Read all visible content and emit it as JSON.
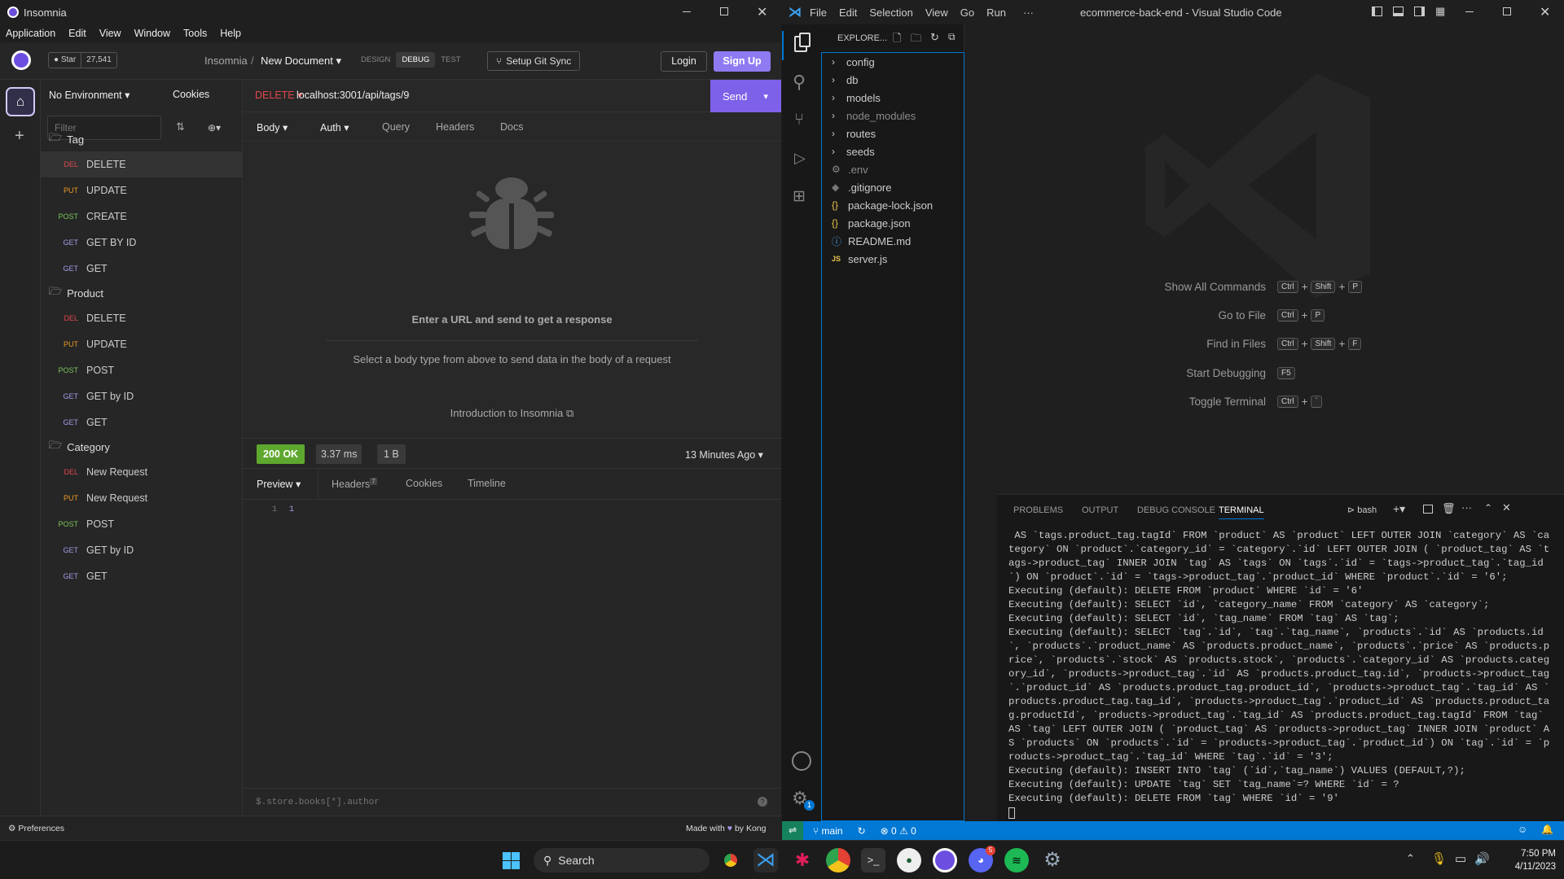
{
  "insomnia": {
    "window_title": "Insomnia",
    "menu": [
      "Application",
      "Edit",
      "View",
      "Window",
      "Tools",
      "Help"
    ],
    "star_label": "Star",
    "star_count": "27,541",
    "breadcrumb_root": "Insomnia",
    "breadcrumb_sep": "/",
    "breadcrumb_doc": "New Document",
    "tabs": [
      "DESIGN",
      "DEBUG",
      "TEST"
    ],
    "git_sync": "Setup Git Sync",
    "login": "Login",
    "signup": "Sign Up",
    "environment": "No Environment",
    "cookies": "Cookies",
    "filter_placeholder": "Filter",
    "folders": [
      {
        "name": "Tag",
        "items": [
          {
            "method": "DEL",
            "label": "DELETE"
          },
          {
            "method": "PUT",
            "label": "UPDATE"
          },
          {
            "method": "POST",
            "label": "CREATE"
          },
          {
            "method": "GET",
            "label": "GET BY ID"
          },
          {
            "method": "GET",
            "label": "GET"
          }
        ]
      },
      {
        "name": "Product",
        "items": [
          {
            "method": "DEL",
            "label": "DELETE"
          },
          {
            "method": "PUT",
            "label": "UPDATE"
          },
          {
            "method": "POST",
            "label": "POST"
          },
          {
            "method": "GET",
            "label": "GET by ID"
          },
          {
            "method": "GET",
            "label": "GET"
          }
        ]
      },
      {
        "name": "Category",
        "items": [
          {
            "method": "DEL",
            "label": "New Request"
          },
          {
            "method": "PUT",
            "label": "New Request"
          },
          {
            "method": "POST",
            "label": "POST"
          },
          {
            "method": "GET",
            "label": "GET by ID"
          },
          {
            "method": "GET",
            "label": "GET"
          }
        ]
      }
    ],
    "method": "DELETE",
    "url": "localhost:3001/api/tags/9",
    "send": "Send",
    "req_tabs": {
      "body": "Body",
      "auth": "Auth",
      "query": "Query",
      "headers": "Headers",
      "docs": "Docs"
    },
    "empty_title": "Enter a URL and send to get a response",
    "empty_sub": "Select a body type from above to send data in the body of a request",
    "intro_link": "Introduction to Insomnia",
    "status": "200 OK",
    "time": "3.37 ms",
    "size": "1 B",
    "ago": "13 Minutes Ago",
    "res_tabs": {
      "preview": "Preview",
      "headers": "Headers",
      "headers_count": "7",
      "cookies": "Cookies",
      "timeline": "Timeline"
    },
    "line_no": "1",
    "line_val": "1",
    "filter_expr_placeholder": "$.store.books[*].author",
    "preferences": "Preferences",
    "made_with": "Made with",
    "by_kong": "by Kong"
  },
  "vscode": {
    "menu": [
      "File",
      "Edit",
      "Selection",
      "View",
      "Go",
      "Run"
    ],
    "menu_more": "···",
    "window_title": "ecommerce-back-end - Visual Studio Code",
    "explorer_title": "EXPLORE...",
    "tree": [
      {
        "type": "folder",
        "name": "config"
      },
      {
        "type": "folder",
        "name": "db"
      },
      {
        "type": "folder",
        "name": "models"
      },
      {
        "type": "folder",
        "name": "node_modules"
      },
      {
        "type": "folder",
        "name": "routes"
      },
      {
        "type": "folder",
        "name": "seeds"
      },
      {
        "type": "env",
        "name": ".env"
      },
      {
        "type": "git",
        "name": ".gitignore"
      },
      {
        "type": "json",
        "name": "package-lock.json"
      },
      {
        "type": "json",
        "name": "package.json"
      },
      {
        "type": "info",
        "name": "README.md"
      },
      {
        "type": "js",
        "name": "server.js"
      }
    ],
    "shortcuts": [
      {
        "label": "Show All Commands",
        "keys": [
          "Ctrl",
          "Shift",
          "P"
        ]
      },
      {
        "label": "Go to File",
        "keys": [
          "Ctrl",
          "P"
        ]
      },
      {
        "label": "Find in Files",
        "keys": [
          "Ctrl",
          "Shift",
          "F"
        ]
      },
      {
        "label": "Start Debugging",
        "keys": [
          "F5"
        ]
      },
      {
        "label": "Toggle Terminal",
        "keys": [
          "Ctrl",
          "`"
        ]
      }
    ],
    "panel_tabs": [
      "PROBLEMS",
      "OUTPUT",
      "DEBUG CONSOLE",
      "TERMINAL"
    ],
    "shell": "bash",
    "terminal": " AS `tags.product_tag.tagId` FROM `product` AS `product` LEFT OUTER JOIN `category` AS `category` ON `product`.`category_id` = `category`.`id` LEFT OUTER JOIN ( `product_tag` AS `tags->product_tag` INNER JOIN `tag` AS `tags` ON `tags`.`id` = `tags->product_tag`.`tag_id`) ON `product`.`id` = `tags->product_tag`.`product_id` WHERE `product`.`id` = '6';\nExecuting (default): DELETE FROM `product` WHERE `id` = '6'\nExecuting (default): SELECT `id`, `category_name` FROM `category` AS `category`;\nExecuting (default): SELECT `id`, `tag_name` FROM `tag` AS `tag`;\nExecuting (default): SELECT `tag`.`id`, `tag`.`tag_name`, `products`.`id` AS `products.id`, `products`.`product_name` AS `products.product_name`, `products`.`price` AS `products.price`, `products`.`stock` AS `products.stock`, `products`.`category_id` AS `products.category_id`, `products->product_tag`.`id` AS `products.product_tag.id`, `products->product_tag`.`product_id` AS `products.product_tag.product_id`, `products->product_tag`.`tag_id` AS `products.product_tag.tag_id`, `products->product_tag`.`product_id` AS `products.product_tag.productId`, `products->product_tag`.`tag_id` AS `products.product_tag.tagId` FROM `tag` AS `tag` LEFT OUTER JOIN ( `product_tag` AS `products->product_tag` INNER JOIN `product` AS `products` ON `products`.`id` = `products->product_tag`.`product_id`) ON `tag`.`id` = `products->product_tag`.`tag_id` WHERE `tag`.`id` = '3';\nExecuting (default): INSERT INTO `tag` (`id`,`tag_name`) VALUES (DEFAULT,?);\nExecuting (default): UPDATE `tag` SET `tag_name`=? WHERE `id` = ?\nExecuting (default): DELETE FROM `tag` WHERE `id` = '9'",
    "status_branch": "main",
    "status_errors": "0",
    "status_warnings": "0",
    "settings_badge": "1"
  },
  "taskbar": {
    "search": "Search",
    "time": "7:50 PM",
    "date": "4/11/2023",
    "discord_badge": "5"
  },
  "colors": {
    "insomnia_accent": "#7e61e9",
    "vscode_blue": "#0078d4",
    "ok_green": "#5fa82f"
  }
}
